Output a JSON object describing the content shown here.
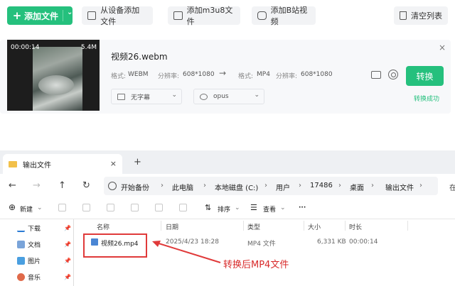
{
  "toolbar": {
    "add_file": "添加文件",
    "add_from_device": "从设备添加文件",
    "add_m3u8": "添加m3u8文件",
    "add_bilibili": "添加B站视频",
    "clear_list": "清空列表"
  },
  "file_card": {
    "thumb_time": "00:00:14",
    "thumb_size": "5.4M",
    "file_name": "视频26.webm",
    "src_format_label": "格式:",
    "src_format": "WEBM",
    "src_res_label": "分辨率:",
    "src_res": "608*1080",
    "dst_format_label": "格式:",
    "dst_format": "MP4",
    "dst_res_label": "分辨率:",
    "dst_res": "608*1080",
    "subtitle_option": "无字幕",
    "audio_option": "opus",
    "convert_button": "转换",
    "status": "转换成功",
    "accent_color": "#25c07d"
  },
  "explorer": {
    "tab_title": "输出文件",
    "breadcrumb": [
      "开始备份",
      "此电脑",
      "本地磁盘 (C:)",
      "用户",
      "17486",
      "桌面",
      "输出文件"
    ],
    "breadcrumb_trailing": "在",
    "cmd": {
      "new": "新建",
      "sort": "排序",
      "view": "查看",
      "more": "···"
    },
    "sidebar": [
      {
        "label": "下载",
        "icon": "download-icon"
      },
      {
        "label": "文档",
        "icon": "document-icon"
      },
      {
        "label": "图片",
        "icon": "picture-icon"
      },
      {
        "label": "音乐",
        "icon": "music-icon"
      }
    ],
    "columns": {
      "name": "名称",
      "date": "日期",
      "type": "类型",
      "size": "大小",
      "duration": "时长"
    },
    "file_row": {
      "name": "视频26.mp4",
      "date": "2025/4/23 18:28",
      "type": "MP4 文件",
      "size": "6,331 KB",
      "duration": "00:00:14"
    }
  },
  "annotation": {
    "text": "转换后MP4文件",
    "color": "#e03a3a"
  }
}
